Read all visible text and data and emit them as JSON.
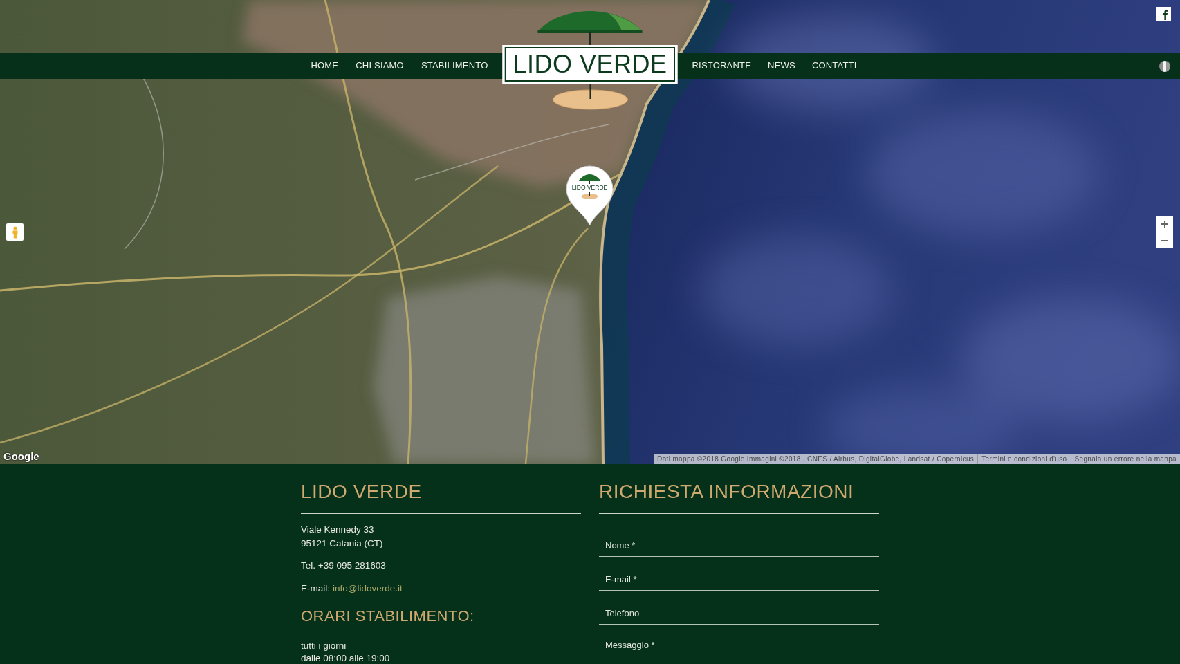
{
  "nav": {
    "items_left": [
      {
        "label": "HOME"
      },
      {
        "label": "CHI SIAMO"
      },
      {
        "label": "STABILIMENTO"
      }
    ],
    "logo": "LIDO VERDE",
    "items_right": [
      {
        "label": "RISTORANTE"
      },
      {
        "label": "NEWS"
      },
      {
        "label": "CONTATTI"
      }
    ]
  },
  "map": {
    "marker_label": "LIDO VERDE",
    "provider_logo": "Google",
    "attribution": {
      "data": "Dati mappa ©2018 Google Immagini ©2018 , CNES / Airbus, DigitalGlobe, Landsat / Copernicus",
      "terms": "Termini e condizioni d'uso",
      "report": "Segnala un errore nella mappa"
    }
  },
  "footer": {
    "contact": {
      "title": "LIDO VERDE",
      "address": [
        "Viale Kennedy 33",
        "95121 Catania (CT)"
      ],
      "phone": "Tel. +39 095 281603",
      "email_label": "E-mail:",
      "email": "info@lidoverde.it",
      "hours_title": "ORARI STABILIMENTO:",
      "hours": [
        "tutti i giorni",
        "dalle 08:00 alle 19:00"
      ]
    },
    "form": {
      "title": "RICHIESTA INFORMAZIONI",
      "fields": [
        {
          "kind": "input",
          "placeholder": "Nome *"
        },
        {
          "kind": "input",
          "placeholder": "E-mail *"
        },
        {
          "kind": "input",
          "placeholder": "Telefono"
        },
        {
          "kind": "textarea",
          "placeholder": "Messaggio *"
        }
      ]
    }
  }
}
